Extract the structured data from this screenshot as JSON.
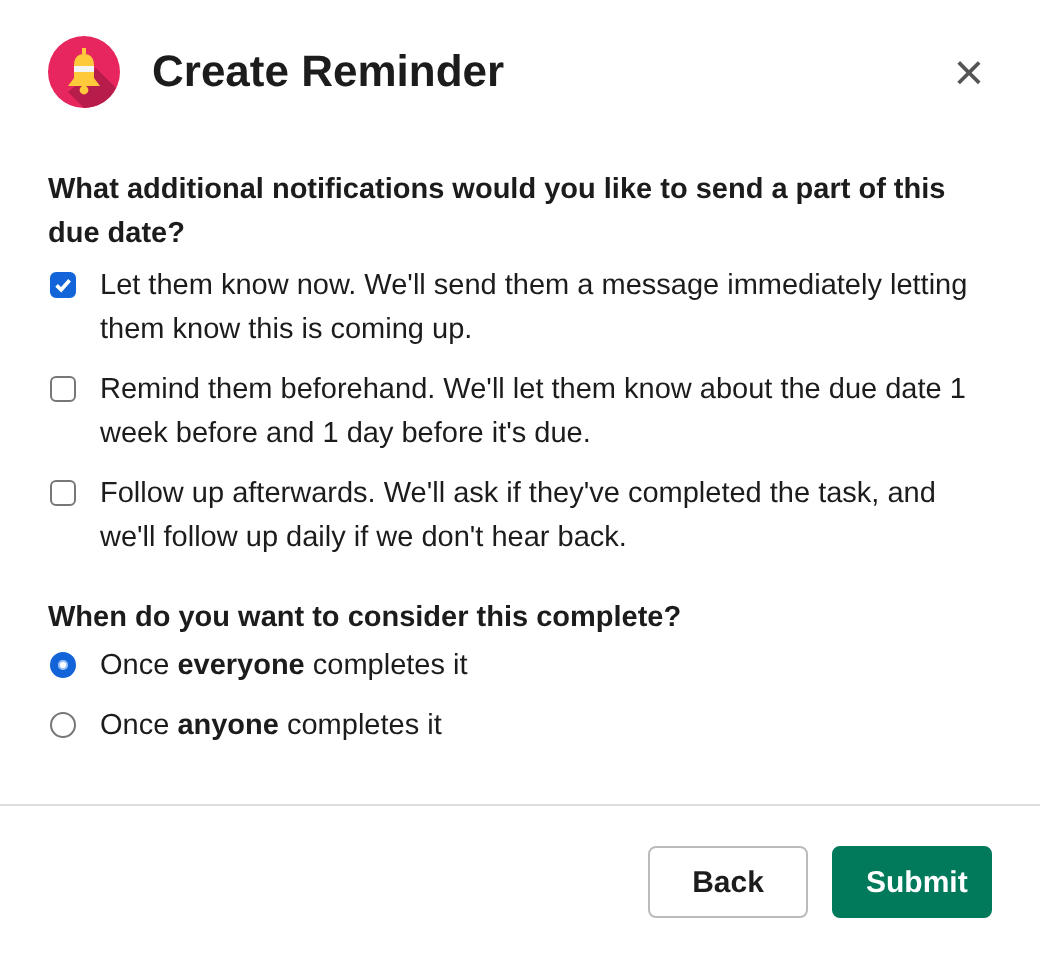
{
  "dialog": {
    "title": "Create Reminder",
    "close": "×"
  },
  "notifications": {
    "question": "What additional notifications would you like to send a part of this due date?",
    "options": [
      {
        "label": "Let them know now. We'll send them a message immediately letting them know this is coming up.",
        "checked": true
      },
      {
        "label": "Remind them beforehand. We'll let them know about the due date 1 week before and 1 day before it's due.",
        "checked": false
      },
      {
        "label": "Follow up afterwards. We'll ask if they've completed the task, and we'll follow up daily if we don't hear back.",
        "checked": false
      }
    ]
  },
  "completion": {
    "question": "When do you want to consider this complete?",
    "options": [
      {
        "label": "Once **everyone** completes it",
        "selected": true
      },
      {
        "label": "Once **anyone** completes it",
        "selected": false
      }
    ]
  },
  "buttons": [
    {
      "label": "Back",
      "kind": "secondary"
    },
    {
      "label": "Submit",
      "kind": "primary"
    }
  ]
}
